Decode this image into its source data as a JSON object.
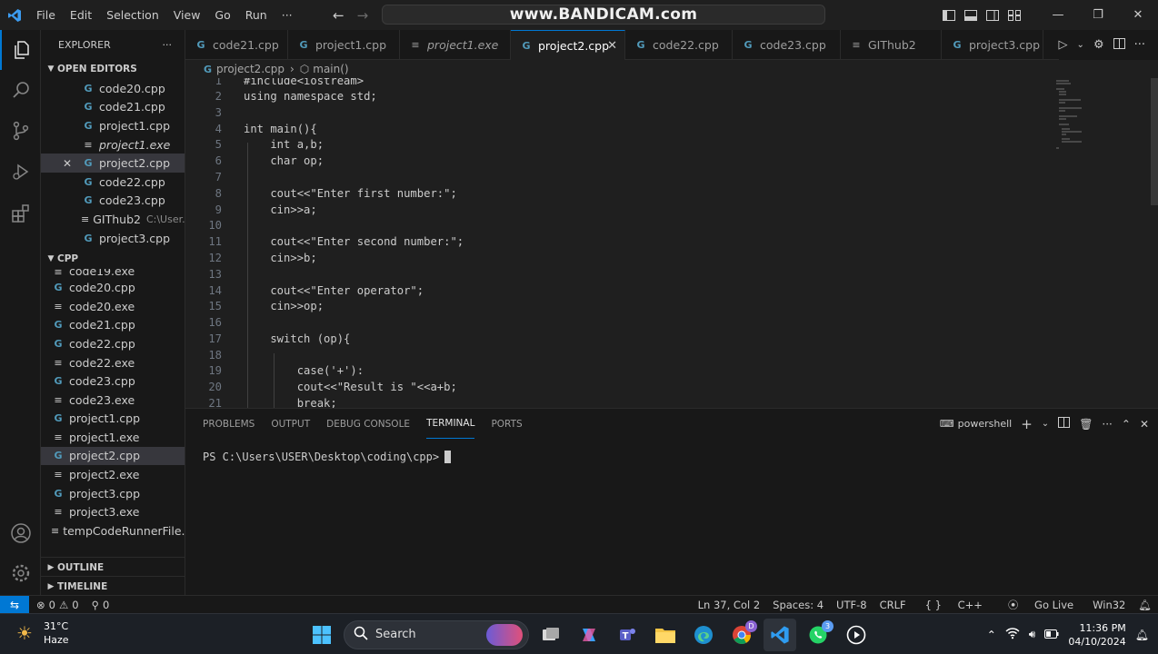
{
  "titlebar": {
    "menus": [
      "File",
      "Edit",
      "Selection",
      "View",
      "Go",
      "Run",
      "···"
    ],
    "command_center": "www.BANDICAM.com"
  },
  "sidebar": {
    "title": "EXPLORER",
    "more": "···",
    "open_editors": {
      "header": "OPEN EDITORS",
      "items": [
        {
          "name": "code20.cpp"
        },
        {
          "name": "code21.cpp"
        },
        {
          "name": "project1.cpp"
        },
        {
          "name": "project1.exe"
        },
        {
          "name": "project2.cpp"
        },
        {
          "name": "code22.cpp"
        },
        {
          "name": "code23.cpp"
        },
        {
          "name": "GIThub2",
          "desc": "C:\\User..."
        },
        {
          "name": "project3.cpp"
        }
      ]
    },
    "folder": {
      "header": "CPP",
      "items": [
        "code19.exe",
        "code20.cpp",
        "code20.exe",
        "code21.cpp",
        "code22.cpp",
        "code22.exe",
        "code23.cpp",
        "code23.exe",
        "project1.cpp",
        "project1.exe",
        "project2.cpp",
        "project2.exe",
        "project3.cpp",
        "project3.exe",
        "tempCodeRunnerFile..."
      ]
    },
    "outline": "OUTLINE",
    "timeline": "TIMELINE"
  },
  "tabs": [
    "code21.cpp",
    "project1.cpp",
    "project1.exe",
    "project2.cpp",
    "code22.cpp",
    "code23.cpp",
    "GIThub2",
    "project3.cpp"
  ],
  "breadcrumb": {
    "file": "project2.cpp",
    "symbol": "main()"
  },
  "editor": {
    "line_numbers": [
      "1",
      "2",
      "3",
      "4",
      "5",
      "6",
      "7",
      "8",
      "9",
      "10",
      "11",
      "12",
      "13",
      "14",
      "15",
      "16",
      "17",
      "18",
      "19",
      "20",
      "21"
    ],
    "lines": [
      "#include<iostream>",
      "using namespace std;",
      "",
      "int main(){",
      "    int a,b;",
      "    char op;",
      "",
      "    cout<<\"Enter first number:\";",
      "    cin>>a;",
      "",
      "    cout<<\"Enter second number:\";",
      "    cin>>b;",
      "",
      "    cout<<\"Enter operator\";",
      "    cin>>op;",
      "",
      "    switch (op){",
      "",
      "        case('+'):",
      "        cout<<\"Result is \"<<a+b;",
      "        break;"
    ]
  },
  "panel": {
    "tabs": [
      "PROBLEMS",
      "OUTPUT",
      "DEBUG CONSOLE",
      "TERMINAL",
      "PORTS"
    ],
    "active_tab": "TERMINAL",
    "shell": "powershell",
    "prompt": "PS C:\\Users\\USER\\Desktop\\coding\\cpp>"
  },
  "statusbar": {
    "errors": "0",
    "warnings": "0",
    "ports": "0",
    "position": "Ln 37, Col 2",
    "spaces": "Spaces: 4",
    "encoding": "UTF-8",
    "eol": "CRLF",
    "language": "C++",
    "live": "Go Live",
    "platform": "Win32"
  },
  "taskbar": {
    "temperature": "31°C",
    "condition": "Haze",
    "search": "Search",
    "whatsapp_badge": "3",
    "edge_badge": "D",
    "time": "11:36 PM",
    "date": "04/10/2024"
  },
  "colors": {
    "accent": "#0078d4",
    "cpp_icon": "#519aba",
    "editor_bg": "#1f1f1f",
    "sidebar_bg": "#181818"
  }
}
